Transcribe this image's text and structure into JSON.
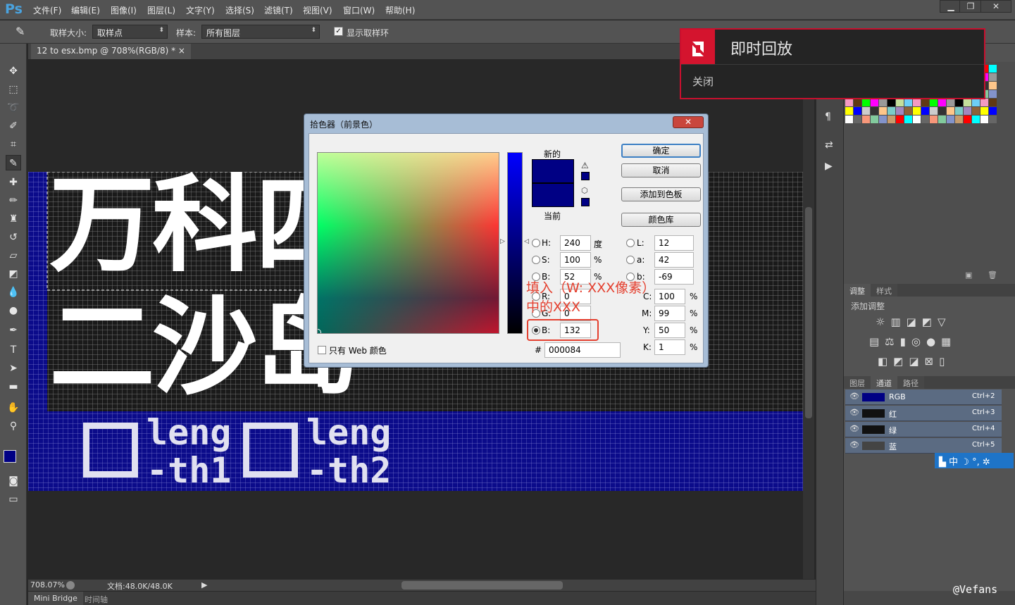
{
  "app": {
    "logo": "Ps"
  },
  "menu": [
    "文件(F)",
    "编辑(E)",
    "图像(I)",
    "图层(L)",
    "文字(Y)",
    "选择(S)",
    "滤镜(T)",
    "视图(V)",
    "窗口(W)",
    "帮助(H)"
  ],
  "window_controls": {
    "minimize": "▁",
    "restore": "❐",
    "close": "✕"
  },
  "options": {
    "sample_size_label": "取样大小:",
    "sample_size_value": "取样点",
    "sample_label": "样本:",
    "sample_value": "所有图层",
    "show_ring_label": "显示取样环"
  },
  "document": {
    "tab_title": "12 to esx.bmp @ 708%(RGB/8) *",
    "tab_close": "×"
  },
  "status": {
    "zoom": "708.07%",
    "doc_info": "文档:48.0K/48.0K"
  },
  "bottom_tabs": [
    "Mini Bridge",
    "时间轴"
  ],
  "canvas_text": {
    "row1": "万科四",
    "row2": "二沙岛",
    "label1": "leng",
    "label1b": "-th1",
    "label2": "leng",
    "label2b": "-th2"
  },
  "picker": {
    "title": "拾色器（前景色）",
    "close": "✕",
    "new_label": "新的",
    "current_label": "当前",
    "new_color": "#000084",
    "current_color": "#000084",
    "buttons": {
      "ok": "确定",
      "cancel": "取消",
      "add_to_swatches": "添加到色板",
      "color_libraries": "颜色库"
    },
    "hsb": [
      {
        "label": "H:",
        "value": "240",
        "unit": "度"
      },
      {
        "label": "S:",
        "value": "100",
        "unit": "%"
      },
      {
        "label": "B:",
        "value": "52",
        "unit": "%"
      }
    ],
    "rgb": [
      {
        "label": "R:",
        "value": "0"
      },
      {
        "label": "G:",
        "value": "0"
      },
      {
        "label": "B:",
        "value": "132"
      }
    ],
    "lab": [
      {
        "label": "L:",
        "value": "12"
      },
      {
        "label": "a:",
        "value": "42"
      },
      {
        "label": "b:",
        "value": "-69"
      }
    ],
    "cmyk": [
      {
        "label": "C:",
        "value": "100",
        "unit": "%"
      },
      {
        "label": "M:",
        "value": "99",
        "unit": "%"
      },
      {
        "label": "Y:",
        "value": "50",
        "unit": "%"
      },
      {
        "label": "K:",
        "value": "1",
        "unit": "%"
      }
    ],
    "hex_label": "#",
    "hex": "000084",
    "web_only": "只有 Web 颜色"
  },
  "annotation": {
    "line1": "填入（W: XXX像素）",
    "line2": "中的XXX"
  },
  "amd_popup": {
    "title": "即时回放",
    "close": "关闭"
  },
  "adjust": {
    "tabs": [
      "调整",
      "样式"
    ],
    "title": "添加调整"
  },
  "layers_tabs": [
    "图层",
    "通道",
    "路径"
  ],
  "channels": [
    {
      "name": "RGB",
      "shortcut": "Ctrl+2"
    },
    {
      "name": "红",
      "shortcut": "Ctrl+3"
    },
    {
      "name": "绿",
      "shortcut": "Ctrl+4"
    },
    {
      "name": "蓝",
      "shortcut": "Ctrl+5"
    }
  ],
  "ime": {
    "lang": "中"
  },
  "watermark": "@Vefans",
  "colors": {
    "accent_red": "#e4402f",
    "amd_red": "#d4142e",
    "fg": "#000084",
    "canvas_blue": "#0b0b8a"
  }
}
